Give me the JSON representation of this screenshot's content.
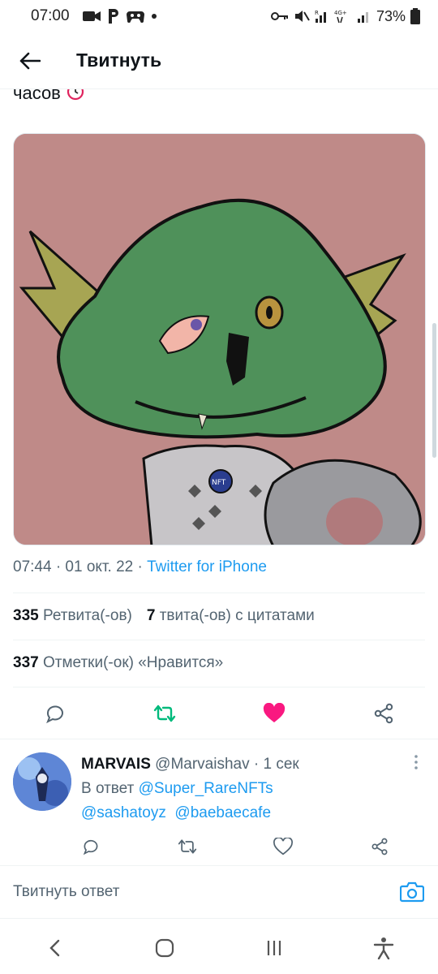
{
  "status_bar": {
    "time": "07:00",
    "left_icons": [
      "video-icon",
      "parking-icon",
      "game-controller-icon",
      "dot-icon"
    ],
    "right_icons": [
      "key-icon",
      "mute-icon",
      "signal-icon",
      "network-4g-icon",
      "signal-icon"
    ],
    "network_label": "4G+",
    "roaming_label": "R",
    "battery": "73%"
  },
  "app_bar": {
    "title": "Твитнуть",
    "back_icon": "arrow-left-icon"
  },
  "tweet": {
    "text_tail": "часов",
    "emoji_icon": "alarm-clock-icon",
    "media_alt": "NFT illustration",
    "timestamp": "07:44 · 01 окт. 22 · ",
    "source": "Twitter for iPhone",
    "retweets_count": "335",
    "retweets_label": "Ретвита(-ов)",
    "quotes_count": "7",
    "quotes_label": "твита(-ов) с цитатами",
    "likes_count": "337",
    "likes_label": "Отметки(-ок) «Нравится»",
    "liked": true,
    "colors": {
      "accent": "#1d9bf0",
      "retweet": "#00ba7c",
      "like": "#f91880",
      "media_background": "#bf8a88"
    }
  },
  "reply": {
    "name": "MARVAIS",
    "handle": "@Marvaishav · 1 сек",
    "reply_to_label": "В ответ",
    "reply_to": "@Super_RareNFTs",
    "mention_1": "@sashatoyz",
    "mention_2": "@baebaecafe"
  },
  "composer": {
    "placeholder": "Твитнуть ответ"
  },
  "nav": [
    "back-nav-icon",
    "home-nav-icon",
    "recents-nav-icon",
    "accessibility-icon"
  ]
}
